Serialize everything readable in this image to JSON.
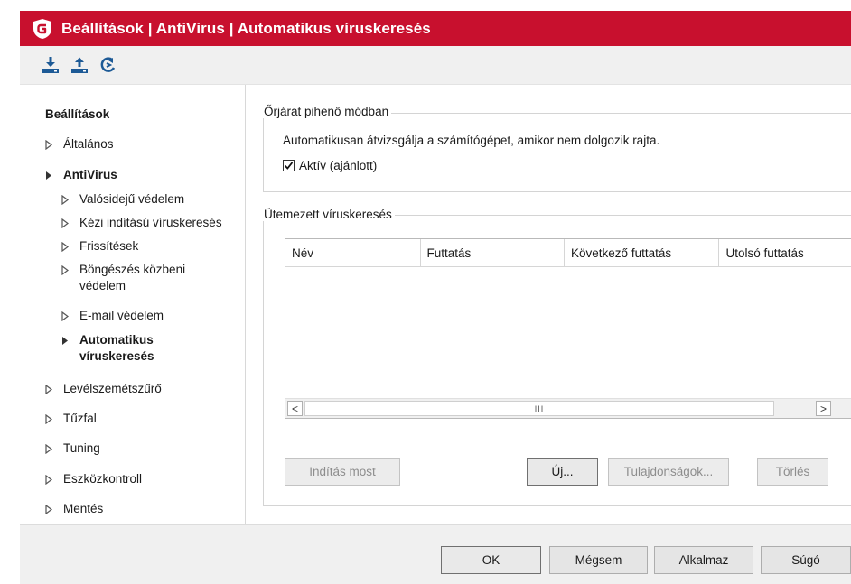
{
  "window": {
    "title": "Beállítások | AntiVirus | Automatikus víruskeresés",
    "brand_color": "#c8102e"
  },
  "toolbar": {
    "buttons": [
      {
        "icon": "download-icon"
      },
      {
        "icon": "upload-icon"
      },
      {
        "icon": "reset-icon"
      }
    ]
  },
  "sidebar": {
    "heading": "Beállítások",
    "items": [
      {
        "label": "Általános",
        "level": 0,
        "expanded": false,
        "bold": false
      },
      {
        "label": "AntiVirus",
        "level": 0,
        "expanded": true,
        "bold": true
      },
      {
        "label": "Valósidejű védelem",
        "level": 1,
        "expanded": false,
        "bold": false
      },
      {
        "label": "Kézi indítású víruskeresés",
        "level": 1,
        "expanded": false,
        "bold": false
      },
      {
        "label": "Frissítések",
        "level": 1,
        "expanded": false,
        "bold": false
      },
      {
        "label": "Böngészés közbeni védelem",
        "level": 1,
        "expanded": false,
        "bold": false
      },
      {
        "label": "E-mail védelem",
        "level": 1,
        "expanded": false,
        "bold": false
      },
      {
        "label": "Automatikus víruskeresés",
        "level": 1,
        "expanded": true,
        "bold": true
      },
      {
        "label": "Levélszemétszűrő",
        "level": 0,
        "expanded": false,
        "bold": false
      },
      {
        "label": "Tűzfal",
        "level": 0,
        "expanded": false,
        "bold": false
      },
      {
        "label": "Tuning",
        "level": 0,
        "expanded": false,
        "bold": false
      },
      {
        "label": "Eszközkontroll",
        "level": 0,
        "expanded": false,
        "bold": false
      },
      {
        "label": "Mentés",
        "level": 0,
        "expanded": false,
        "bold": false
      }
    ]
  },
  "idle_scan": {
    "title": "Őrjárat pihenő módban",
    "description": "Automatikusan átvizsgálja a számítógépet, amikor nem dolgozik rajta.",
    "checkbox_label": "Aktív (ajánlott)",
    "checked": true
  },
  "scheduled": {
    "title": "Ütemezett víruskeresés",
    "columns": [
      "Név",
      "Futtatás",
      "Következő futtatás",
      "Utolsó futtatás"
    ],
    "rows": [],
    "scroll_left": "<",
    "scroll_right": ">",
    "scroll_thumb": "III",
    "buttons": {
      "start_now": "Indítás most",
      "new": "Új...",
      "properties": "Tulajdonságok...",
      "delete": "Törlés"
    }
  },
  "footer": {
    "ok": "OK",
    "cancel": "Mégsem",
    "apply": "Alkalmaz",
    "help": "Súgó"
  }
}
